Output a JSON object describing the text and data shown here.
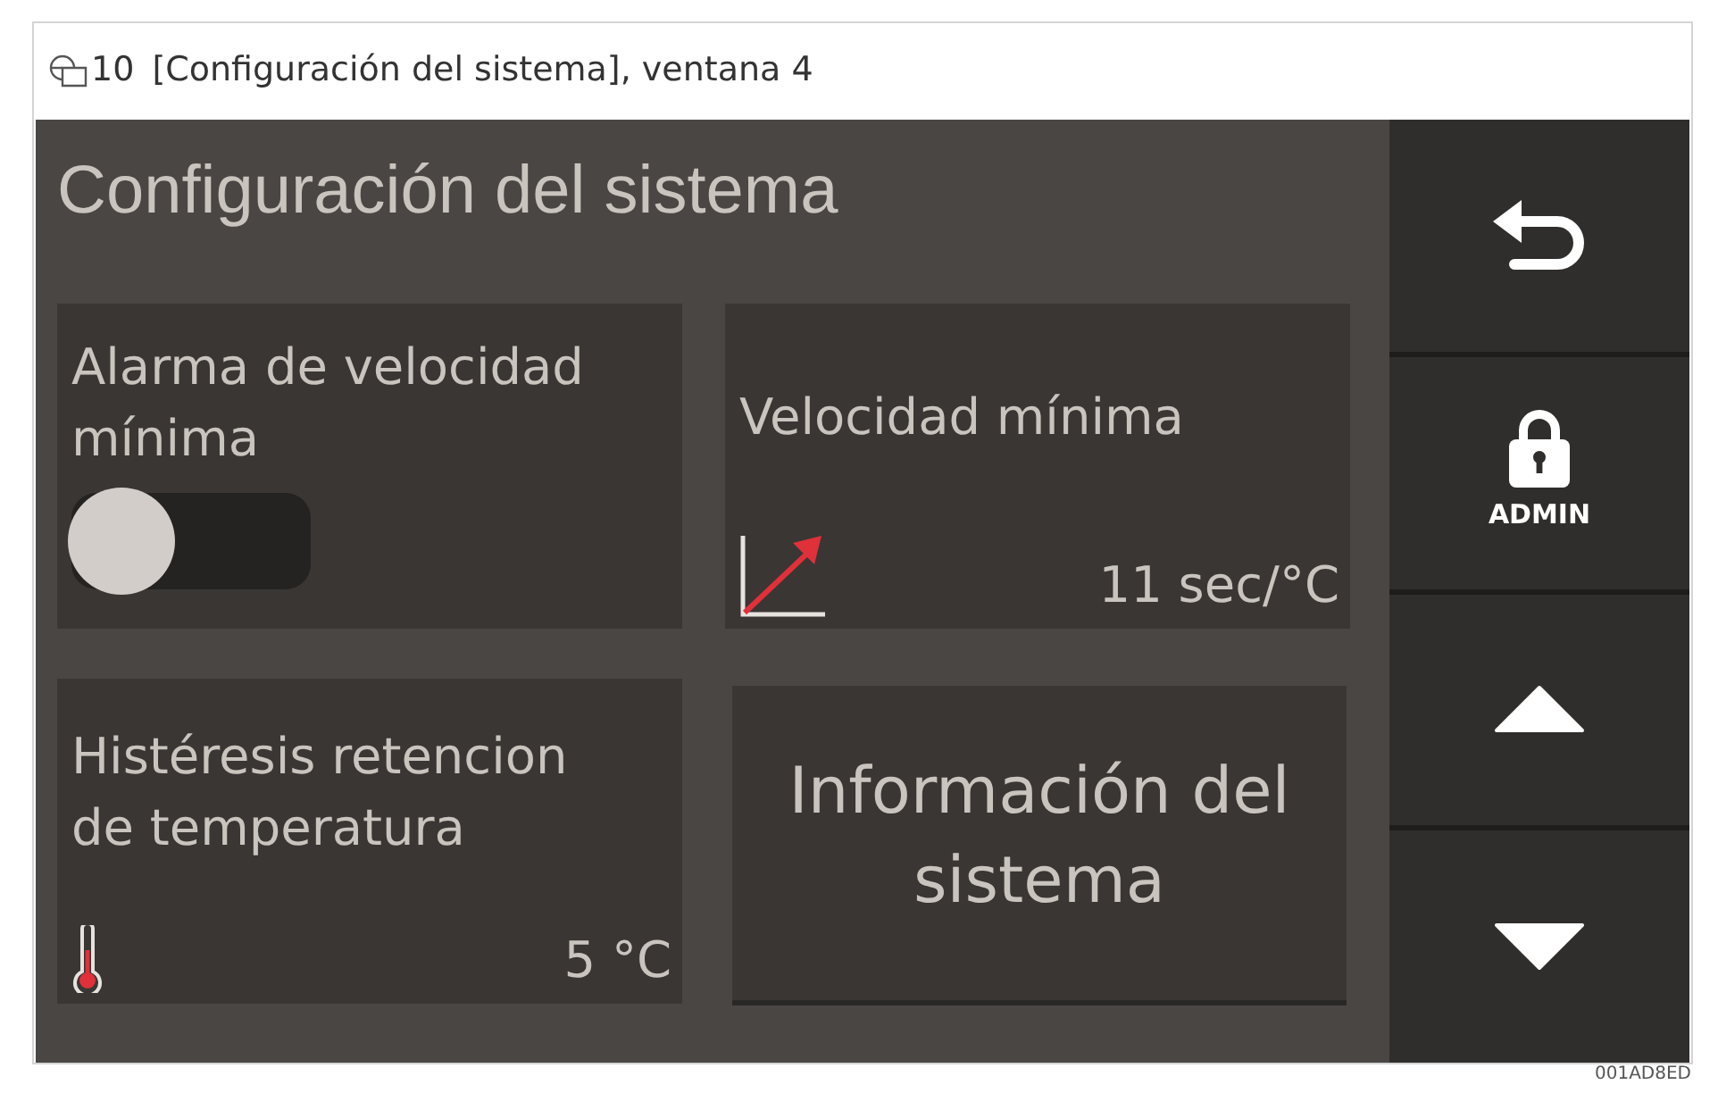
{
  "caption": {
    "number": "10",
    "title": "[Configuración del sistema], ventana 4"
  },
  "screen": {
    "title": "Configuración del sistema",
    "tiles": [
      {
        "kind": "toggle",
        "label": "Alarma de velocidad mínima",
        "on": false
      },
      {
        "kind": "rate",
        "label": "Velocidad mínima",
        "value": "11 sec/°C"
      },
      {
        "kind": "temperature",
        "label": "Histéresis retencion de temperatura",
        "value": "5 °C"
      },
      {
        "kind": "button",
        "label": "Información del sistema"
      }
    ],
    "side_buttons": [
      {
        "kind": "back"
      },
      {
        "kind": "lock",
        "label": "ADMIN"
      },
      {
        "kind": "up"
      },
      {
        "kind": "down"
      }
    ]
  },
  "figure_code": "001AD8ED"
}
